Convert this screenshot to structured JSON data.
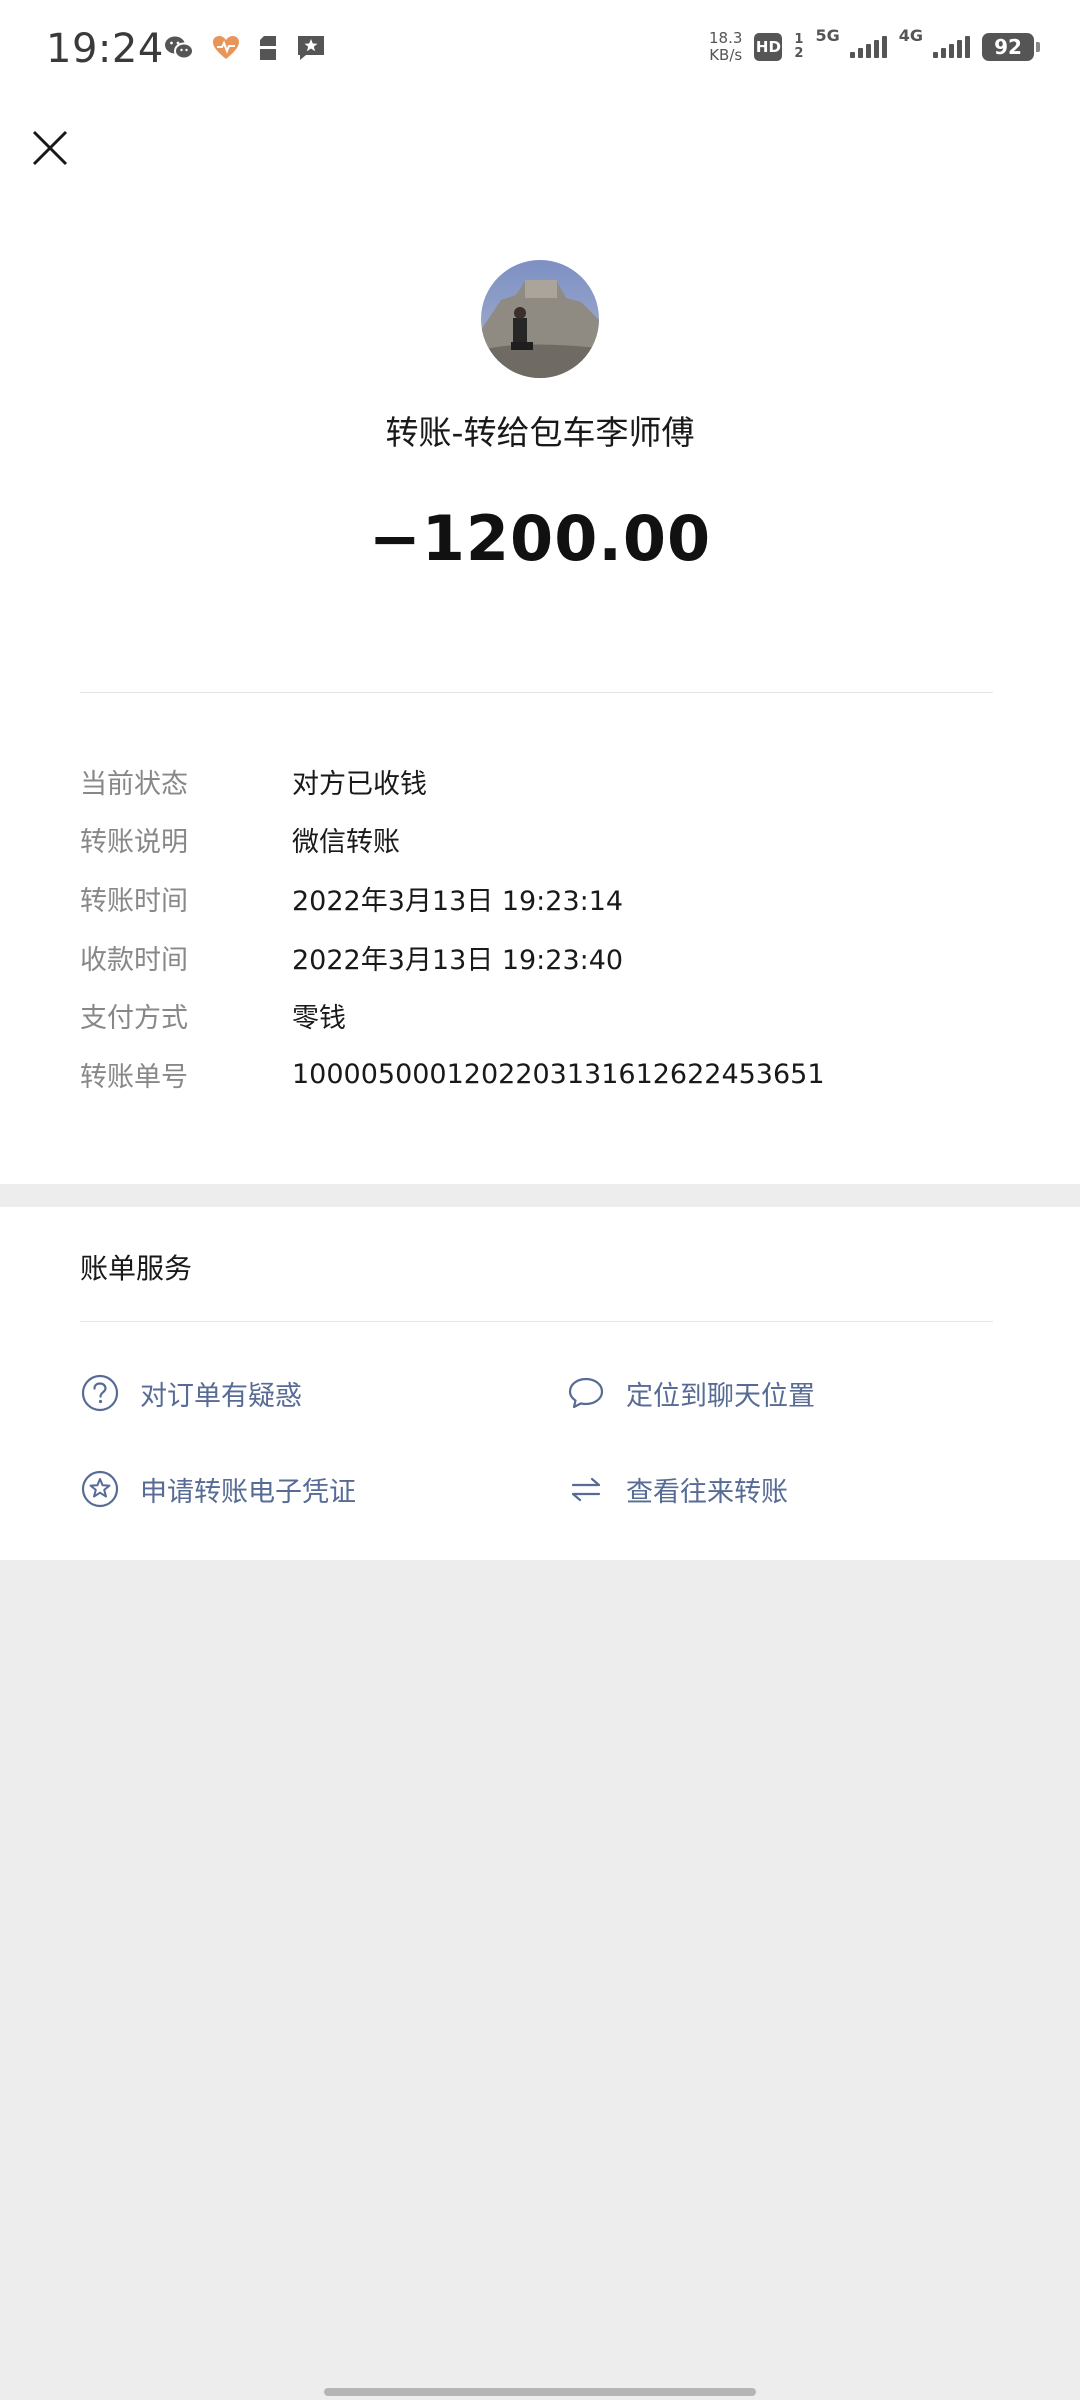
{
  "status_bar": {
    "time": "19:24",
    "net_speed_value": "18.3",
    "net_speed_unit": "KB/s",
    "hd_label": "HD",
    "sim_slot_top": "1",
    "sim_slot_bottom": "2",
    "network_1": "5G",
    "network_2": "4G",
    "battery": "92",
    "icons": [
      "wechat-icon",
      "health-heart-icon",
      "sim-card-icon",
      "message-star-icon"
    ]
  },
  "header": {
    "close_icon": "close-icon"
  },
  "transfer": {
    "title": "转账-转给包车李师傅",
    "amount": "−1200.00"
  },
  "details": [
    {
      "label": "当前状态",
      "value": "对方已收钱"
    },
    {
      "label": "转账说明",
      "value": "微信转账"
    },
    {
      "label": "转账时间",
      "value": "2022年3月13日 19:23:14"
    },
    {
      "label": "收款时间",
      "value": "2022年3月13日 19:23:40"
    },
    {
      "label": "支付方式",
      "value": "零钱"
    },
    {
      "label": "转账单号",
      "value": "100005000120220313161262245365​1"
    }
  ],
  "services": {
    "title": "账单服务",
    "items": [
      {
        "label": "对订单有疑惑",
        "icon": "question-circle-icon"
      },
      {
        "label": "定位到聊天位置",
        "icon": "chat-bubble-icon"
      },
      {
        "label": "申请转账电子凭证",
        "icon": "star-badge-icon"
      },
      {
        "label": "查看往来转账",
        "icon": "swap-arrows-icon"
      }
    ]
  },
  "colors": {
    "link": "#576b95",
    "label": "#888888",
    "background": "#ededed"
  }
}
